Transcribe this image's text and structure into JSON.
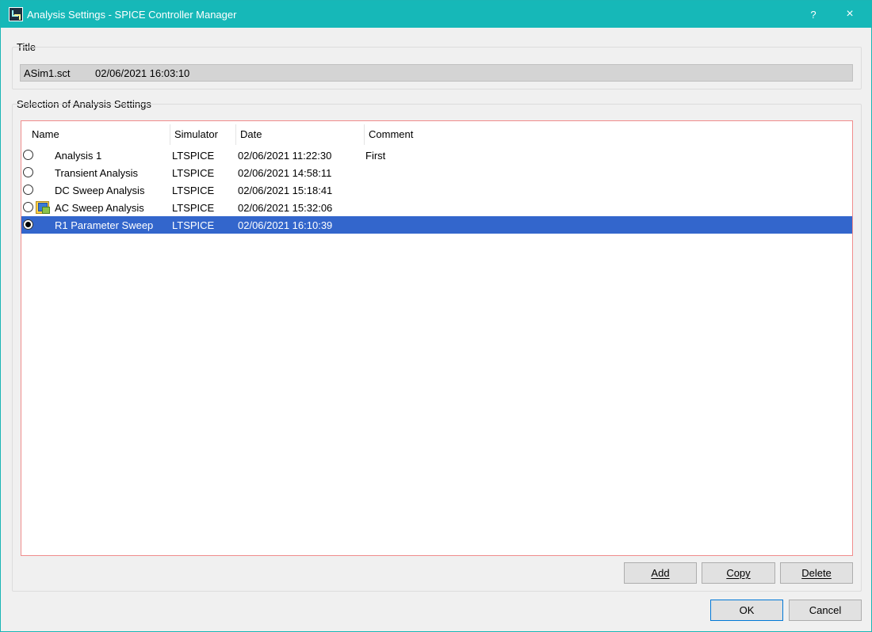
{
  "window": {
    "title": "Analysis Settings - SPICE Controller Manager",
    "help_label": "?",
    "close_label": "×"
  },
  "title_group": {
    "label": "Title",
    "filename": "ASim1.sct",
    "timestamp": "02/06/2021 16:03:10"
  },
  "selection_group": {
    "label": "Selection of Analysis Settings",
    "columns": [
      "Name",
      "Simulator",
      "Date",
      "Comment"
    ],
    "rows": [
      {
        "name": "Analysis 1",
        "simulator": "LTSPICE",
        "date": "02/06/2021 11:22:30",
        "comment": "First"
      },
      {
        "name": "Transient Analysis",
        "simulator": "LTSPICE",
        "date": "02/06/2021 14:58:11",
        "comment": ""
      },
      {
        "name": "DC Sweep Analysis",
        "simulator": "LTSPICE",
        "date": "02/06/2021 15:18:41",
        "comment": ""
      },
      {
        "name": "AC Sweep Analysis",
        "simulator": "LTSPICE",
        "date": "02/06/2021 15:32:06",
        "comment": ""
      },
      {
        "name": "R1 Parameter Sweep",
        "simulator": "LTSPICE",
        "date": "02/06/2021 16:10:39",
        "comment": ""
      }
    ],
    "selected_index": 4,
    "icon_row_index": 3
  },
  "list_buttons": {
    "add_label": "Add",
    "copy_label": "Copy",
    "delete_label": "Delete"
  },
  "dialog_buttons": {
    "ok_label": "OK",
    "cancel_label": "Cancel"
  },
  "colors": {
    "titlebar": "#16b8b8",
    "selection": "#3366cc",
    "list_border": "#f08c8c"
  }
}
